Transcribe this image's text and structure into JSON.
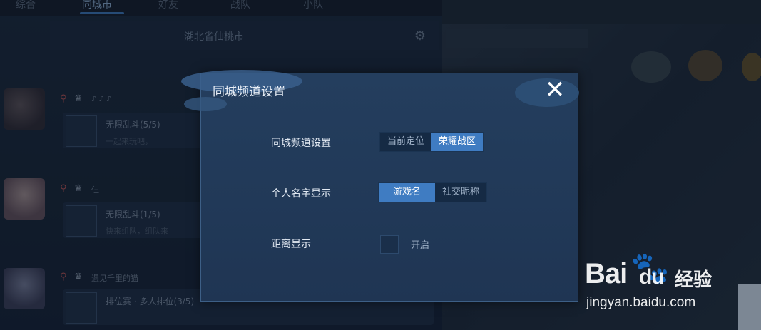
{
  "top_tabs": [
    {
      "label": "综合",
      "active": false
    },
    {
      "label": "同城市",
      "active": true
    },
    {
      "label": "好友",
      "active": false
    },
    {
      "label": "战队",
      "active": false
    },
    {
      "label": "小队",
      "active": false
    }
  ],
  "city": {
    "title": "湖北省仙桃市"
  },
  "chat_rows": [
    {
      "meta": "♪ ♪ ♪",
      "room_title": "无限乱斗(5/5)",
      "room_sub": "一起来玩吧，"
    },
    {
      "meta": "仨",
      "room_title": "无限乱斗(1/5)",
      "room_sub": "快来组队，组队来"
    },
    {
      "meta": "遇见千里的猫",
      "room_title": "排位赛 · 多人排位(3/5)",
      "room_sub": ""
    }
  ],
  "dialog": {
    "title": "同城频道设置",
    "close_icon": "close-icon",
    "settings": [
      {
        "label": "同城频道设置",
        "options": [
          "当前定位",
          "荣耀战区"
        ],
        "selected": "荣耀战区"
      },
      {
        "label": "个人名字显示",
        "options": [
          "游戏名",
          "社交昵称"
        ],
        "selected": "游戏名"
      },
      {
        "label": "距离显示",
        "toggle_text": "开启",
        "checked": false
      }
    ]
  },
  "watermark": {
    "brand_left": "Bai",
    "brand_right": "du",
    "brand_cn": "经验",
    "url": "jingyan.baidu.com"
  },
  "colors": {
    "accent": "#3f7cc2",
    "dialog_bg": "#243e5e",
    "background": "#142233"
  }
}
